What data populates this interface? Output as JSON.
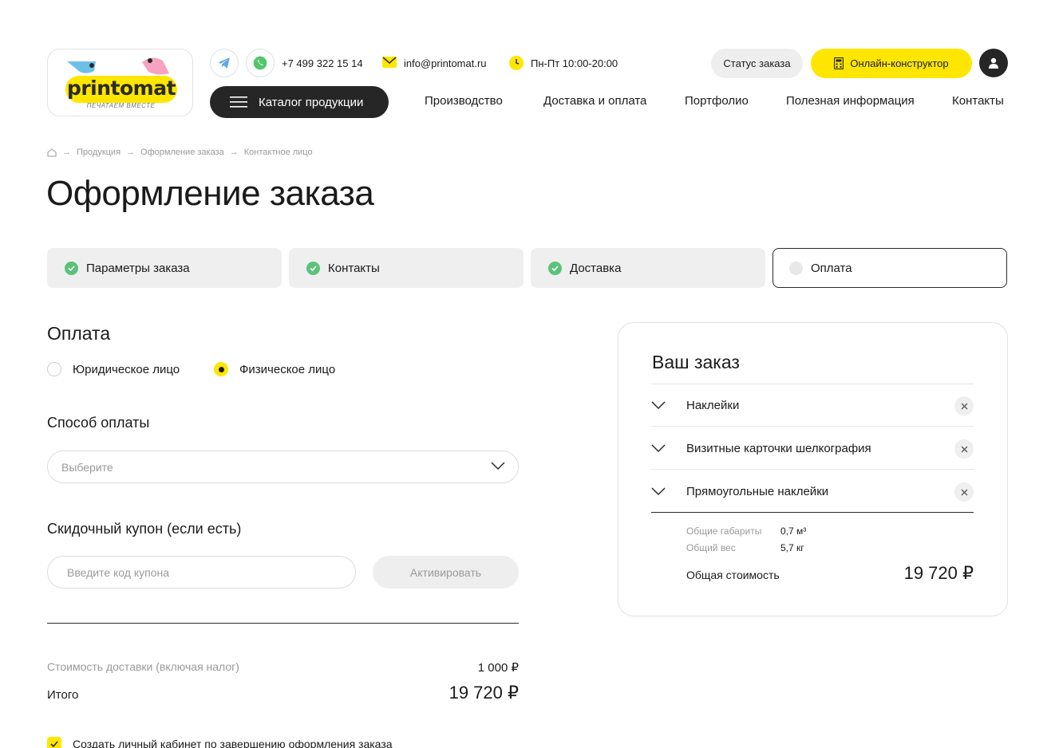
{
  "brand": {
    "name": "printomat",
    "tagline": "ПЕЧАТАЕМ ВМЕСТЕ"
  },
  "header": {
    "phone": "+7 499 322 15 14",
    "email": "info@printomat.ru",
    "hours": "Пн-Пт 10:00-20:00",
    "order_status_label": "Статус заказа",
    "constructor_label": "Онлайн-конструктор",
    "catalog_label": "Каталог продукции",
    "nav": [
      "Производство",
      "Доставка и оплата",
      "Портфолио",
      "Полезная информация",
      "Контакты"
    ]
  },
  "breadcrumb": [
    "Продукция",
    "Оформление заказа",
    "Контактное лицо"
  ],
  "page_title": "Оформление заказа",
  "steps": [
    {
      "label": "Параметры заказа",
      "done": true
    },
    {
      "label": "Контакты",
      "done": true
    },
    {
      "label": "Доставка",
      "done": true
    },
    {
      "label": "Оплата",
      "done": false
    }
  ],
  "payment": {
    "title": "Оплата",
    "person_types": [
      {
        "label": "Юридическое лицо",
        "selected": false
      },
      {
        "label": "Физическое лицо",
        "selected": true
      }
    ],
    "method_title": "Способ оплаты",
    "method_placeholder": "Выберите",
    "coupon_title": "Скидочный купон (если есть)",
    "coupon_placeholder": "Введите код купона",
    "activate_label": "Активировать",
    "delivery_cost_label": "Стоимость доставки (включая налог)",
    "delivery_cost_value": "1 000 ₽",
    "total_label": "Итого",
    "total_value": "19 720 ₽",
    "create_account_label": "Создать личный кабинет по завершению оформления заказа",
    "create_account_checked": true
  },
  "order": {
    "title": "Ваш заказ",
    "items": [
      "Наклейки",
      "Визитные карточки шелкография",
      "Прямоугольные наклейки"
    ],
    "dims_label": "Общие габариты",
    "dims_value": "0,7 м³",
    "weight_label": "Общий вес",
    "weight_value": "5,7 кг",
    "total_label": "Общая стоимость",
    "total_value": "19 720 ₽"
  },
  "colors": {
    "accent": "#ffe600",
    "dark": "#262626",
    "success": "#5cc27a"
  }
}
